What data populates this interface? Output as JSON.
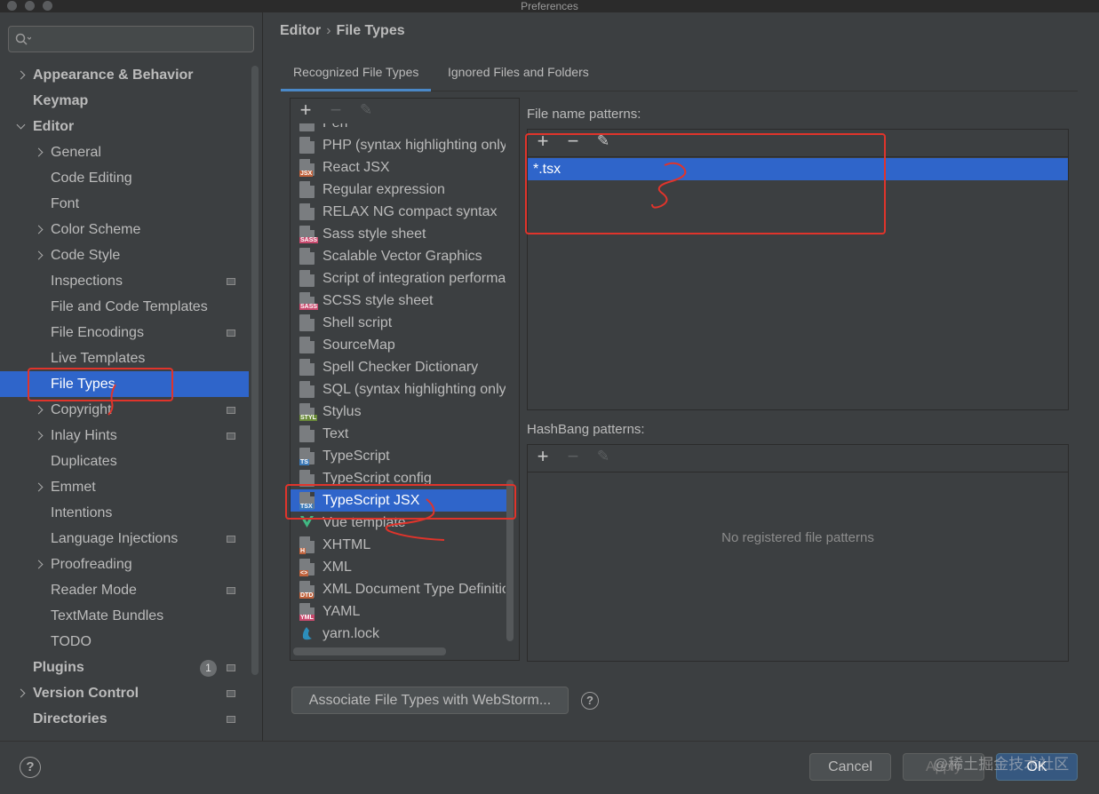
{
  "window": {
    "title": "Preferences"
  },
  "search": {
    "placeholder": "",
    "value": ""
  },
  "sidebar": {
    "items": [
      {
        "label": "Appearance & Behavior",
        "bold": true,
        "chevron": "right",
        "level": 0
      },
      {
        "label": "Keymap",
        "bold": true,
        "level": 0
      },
      {
        "label": "Editor",
        "bold": true,
        "chevron": "down",
        "level": 0
      },
      {
        "label": "General",
        "chevron": "right",
        "level": 1
      },
      {
        "label": "Code Editing",
        "level": 1
      },
      {
        "label": "Font",
        "level": 1
      },
      {
        "label": "Color Scheme",
        "chevron": "right",
        "level": 1
      },
      {
        "label": "Code Style",
        "chevron": "right",
        "level": 1
      },
      {
        "label": "Inspections",
        "level": 1,
        "indicator": true
      },
      {
        "label": "File and Code Templates",
        "level": 1
      },
      {
        "label": "File Encodings",
        "level": 1,
        "indicator": true
      },
      {
        "label": "Live Templates",
        "level": 1
      },
      {
        "label": "File Types",
        "level": 1,
        "selected": true
      },
      {
        "label": "Copyright",
        "chevron": "right",
        "level": 1,
        "indicator": true
      },
      {
        "label": "Inlay Hints",
        "chevron": "right",
        "level": 1,
        "indicator": true
      },
      {
        "label": "Duplicates",
        "level": 1
      },
      {
        "label": "Emmet",
        "chevron": "right",
        "level": 1
      },
      {
        "label": "Intentions",
        "level": 1
      },
      {
        "label": "Language Injections",
        "level": 1,
        "indicator": true
      },
      {
        "label": "Proofreading",
        "chevron": "right",
        "level": 1
      },
      {
        "label": "Reader Mode",
        "level": 1,
        "indicator": true
      },
      {
        "label": "TextMate Bundles",
        "level": 1
      },
      {
        "label": "TODO",
        "level": 1
      },
      {
        "label": "Plugins",
        "bold": true,
        "level": 0,
        "badge": "1",
        "indicator": true
      },
      {
        "label": "Version Control",
        "bold": true,
        "chevron": "right",
        "level": 0,
        "indicator": true
      },
      {
        "label": "Directories",
        "bold": true,
        "level": 0,
        "indicator": true
      }
    ]
  },
  "breadcrumb": {
    "parent": "Editor",
    "separator": "›",
    "current": "File Types"
  },
  "tabs": [
    {
      "label": "Recognized File Types",
      "active": true
    },
    {
      "label": "Ignored Files and Folders",
      "active": false
    }
  ],
  "file_types": {
    "toolbar": {
      "add": "+",
      "remove": "−",
      "edit": "✎"
    },
    "items": [
      {
        "name": "Perl",
        "icon": "perl-file-icon",
        "partial": true
      },
      {
        "name": "PHP (syntax highlighting only)",
        "icon": "php-file-icon"
      },
      {
        "name": "React JSX",
        "icon": "jsx-file-icon",
        "tag": "JSX",
        "tag_color": "#c0623c"
      },
      {
        "name": "Regular expression",
        "icon": "regex-file-icon"
      },
      {
        "name": "RELAX NG compact syntax",
        "icon": "relaxng-file-icon"
      },
      {
        "name": "Sass style sheet",
        "icon": "sass-file-icon",
        "tag": "SASS",
        "tag_color": "#c94a6e"
      },
      {
        "name": "Scalable Vector Graphics",
        "icon": "svg-file-icon"
      },
      {
        "name": "Script of integration performance tests",
        "icon": "script-file-icon"
      },
      {
        "name": "SCSS style sheet",
        "icon": "scss-file-icon",
        "tag": "SASS",
        "tag_color": "#c94a6e"
      },
      {
        "name": "Shell script",
        "icon": "shell-file-icon"
      },
      {
        "name": "SourceMap",
        "icon": "sourcemap-file-icon"
      },
      {
        "name": "Spell Checker Dictionary",
        "icon": "dictionary-file-icon"
      },
      {
        "name": "SQL (syntax highlighting only)",
        "icon": "sql-file-icon"
      },
      {
        "name": "Stylus",
        "icon": "stylus-file-icon",
        "tag": "STYL",
        "tag_color": "#6a8a3a"
      },
      {
        "name": "Text",
        "icon": "text-file-icon"
      },
      {
        "name": "TypeScript",
        "icon": "typescript-file-icon",
        "tag": "TS",
        "tag_color": "#3d7ab8"
      },
      {
        "name": "TypeScript config",
        "icon": "tsconfig-file-icon"
      },
      {
        "name": "TypeScript JSX",
        "icon": "tsx-file-icon",
        "tag": "TSX",
        "tag_color": "#3d7ab8",
        "selected": true
      },
      {
        "name": "Vue template",
        "icon": "vue-file-icon"
      },
      {
        "name": "XHTML",
        "icon": "xhtml-file-icon",
        "tag": "H",
        "tag_color": "#c0623c"
      },
      {
        "name": "XML",
        "icon": "xml-file-icon",
        "tag": "<>",
        "tag_color": "#c0623c"
      },
      {
        "name": "XML Document Type Definition",
        "icon": "dtd-file-icon",
        "tag": "DTD",
        "tag_color": "#c0623c"
      },
      {
        "name": "YAML",
        "icon": "yaml-file-icon",
        "tag": "YML",
        "tag_color": "#c94a6e"
      },
      {
        "name": "yarn.lock",
        "icon": "yarn-icon"
      }
    ]
  },
  "file_name_patterns": {
    "label": "File name patterns:",
    "toolbar": {
      "add": "+",
      "remove": "−",
      "edit": "✎"
    },
    "items": [
      "*.tsx"
    ]
  },
  "hashbang_patterns": {
    "label": "HashBang patterns:",
    "toolbar": {
      "add": "+",
      "remove": "−",
      "edit": "✎"
    },
    "empty_text": "No registered file patterns"
  },
  "associate_button": {
    "label": "Associate File Types with WebStorm..."
  },
  "help": {
    "label": "?"
  },
  "footer": {
    "cancel": "Cancel",
    "apply": "Apply",
    "ok": "OK"
  },
  "watermark": "@稀土掘金技术社区",
  "colors": {
    "selection": "#2f65ca",
    "annotation": "#e0342b",
    "background": "#3c3f41"
  }
}
